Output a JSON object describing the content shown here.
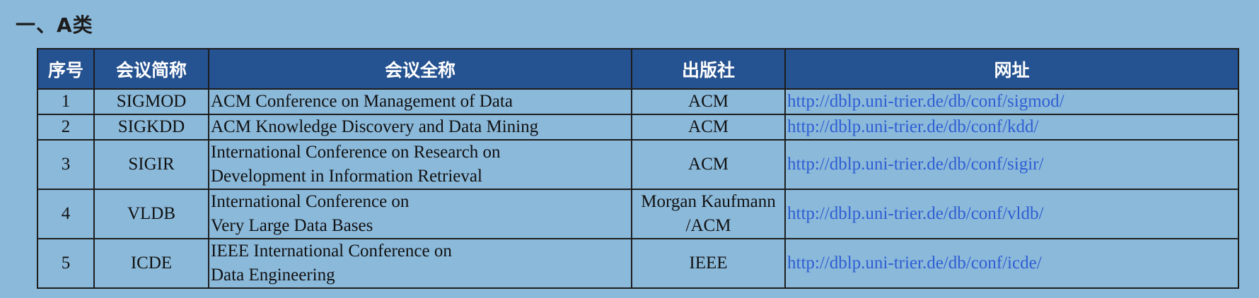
{
  "section": {
    "title": "一、A类"
  },
  "table": {
    "headers": {
      "num": "序号",
      "abbr": "会议简称",
      "full": "会议全称",
      "publisher": "出版社",
      "url": "网址"
    },
    "rows": [
      {
        "num": "1",
        "abbr": "SIGMOD",
        "full": [
          "ACM Conference on Management of Data"
        ],
        "publisher": [
          "ACM"
        ],
        "url": "http://dblp.uni-trier.de/db/conf/sigmod/"
      },
      {
        "num": "2",
        "abbr": "SIGKDD",
        "full": [
          "ACM Knowledge Discovery and Data Mining"
        ],
        "publisher": [
          "ACM"
        ],
        "url": "http://dblp.uni-trier.de/db/conf/kdd/"
      },
      {
        "num": "3",
        "abbr": "SIGIR",
        "full": [
          "International Conference on Research on",
          "Development in Information Retrieval"
        ],
        "publisher": [
          "ACM"
        ],
        "url": "http://dblp.uni-trier.de/db/conf/sigir/"
      },
      {
        "num": "4",
        "abbr": "VLDB",
        "full": [
          "International Conference on",
          "Very Large Data Bases"
        ],
        "publisher": [
          "Morgan Kaufmann",
          "/ACM"
        ],
        "url": "http://dblp.uni-trier.de/db/conf/vldb/"
      },
      {
        "num": "5",
        "abbr": "ICDE",
        "full": [
          "IEEE International Conference on",
          "Data Engineering"
        ],
        "publisher": [
          "IEEE"
        ],
        "url": "http://dblp.uni-trier.de/db/conf/icde/"
      }
    ]
  },
  "colors": {
    "background": "#8bb9da",
    "header_bg": "#255290",
    "header_text": "#ffffff",
    "link": "#2e5ed3"
  }
}
